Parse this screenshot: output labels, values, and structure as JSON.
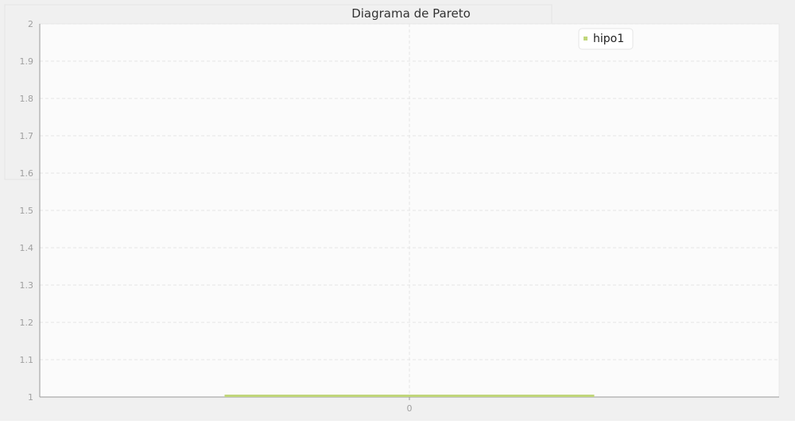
{
  "chart_data": {
    "type": "bar",
    "title": "Diagrama de Pareto",
    "categories": [
      "0"
    ],
    "series": [
      {
        "name": "hipo1",
        "values": [
          1
        ]
      }
    ],
    "ylim": [
      1,
      2
    ],
    "y_ticks": [
      "1",
      "1.1",
      "1.2",
      "1.3",
      "1.4",
      "1.5",
      "1.6",
      "1.7",
      "1.8",
      "1.9",
      "2"
    ],
    "xlabel": "",
    "ylabel": "",
    "grid": true,
    "legend_position": "top-right",
    "colors": {
      "series": "#c0d67a",
      "grid": "#e6e6e6",
      "frame": "#f0f0f0",
      "plot_bg": "#fbfbfb",
      "axis": "#999999",
      "tick_text": "#a0a0a0",
      "title_text": "#333333",
      "legend_text": "#222222"
    }
  }
}
